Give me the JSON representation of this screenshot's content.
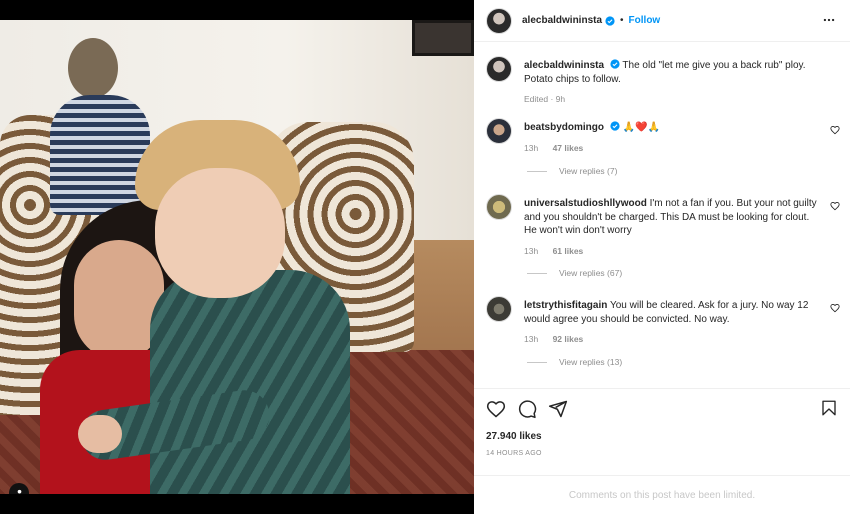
{
  "header": {
    "username": "alecbaldwininsta",
    "separator": "•",
    "follow_label": "Follow"
  },
  "caption": {
    "username": "alecbaldwininsta",
    "text": "The old \"let me give you a back rub\" ploy. Potato chips to follow.",
    "meta": "Edited · 9h"
  },
  "comments": [
    {
      "username": "beatsbydomingo",
      "text": "🙏❤️🙏",
      "age": "13h",
      "likes": "47 likes",
      "replies": "View replies (7)",
      "verified": true
    },
    {
      "username": "universalstudioshllywood",
      "text": "I'm not a fan if you. But your not guilty and you shouldn't be charged. This DA must be looking for clout. He won't win don't worry",
      "age": "13h",
      "likes": "61 likes",
      "replies": "View replies (67)",
      "verified": false
    },
    {
      "username": "letstrythisfitagain",
      "text": "You will be cleared. Ask for a jury. No way 12 would agree you should be convicted. No way.",
      "age": "13h",
      "likes": "92 likes",
      "replies": "View replies (13)",
      "verified": false
    }
  ],
  "footer": {
    "likes": "27.940 likes",
    "time": "14 HOURS AGO",
    "limited_notice": "Comments on this post have been limited."
  },
  "colors": {
    "accent": "#0095f6",
    "verified": "#0095f6"
  }
}
